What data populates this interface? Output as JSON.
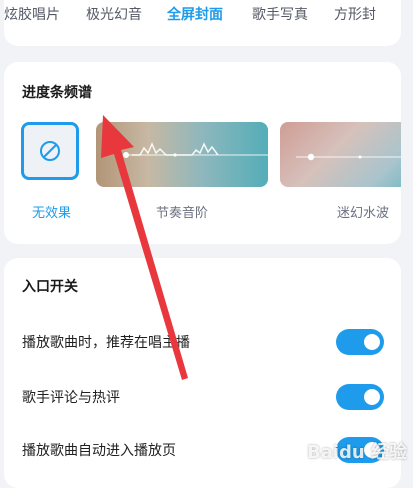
{
  "tabs": [
    "炫胶唱片",
    "极光幻音",
    "全屏封面",
    "歌手写真",
    "方形封"
  ],
  "active_tab": "全屏封面",
  "progress_section": {
    "title": "进度条频谱",
    "effects": [
      {
        "label": "无效果",
        "selected": true,
        "icon": "no-effect-icon"
      },
      {
        "label": "节奏音阶",
        "selected": false
      },
      {
        "label": "迷幻水波",
        "selected": false
      }
    ]
  },
  "entrance_section": {
    "title": "入口开关",
    "rows": [
      {
        "label": "播放歌曲时，推荐在唱主播",
        "enabled": true
      },
      {
        "label": "歌手评论与热评",
        "enabled": true
      },
      {
        "label": "播放歌曲自动进入播放页",
        "enabled": true
      }
    ]
  },
  "accent_color": "#1e9bea",
  "annotation_color": "#e8383d",
  "watermark": "Baidu 经验"
}
